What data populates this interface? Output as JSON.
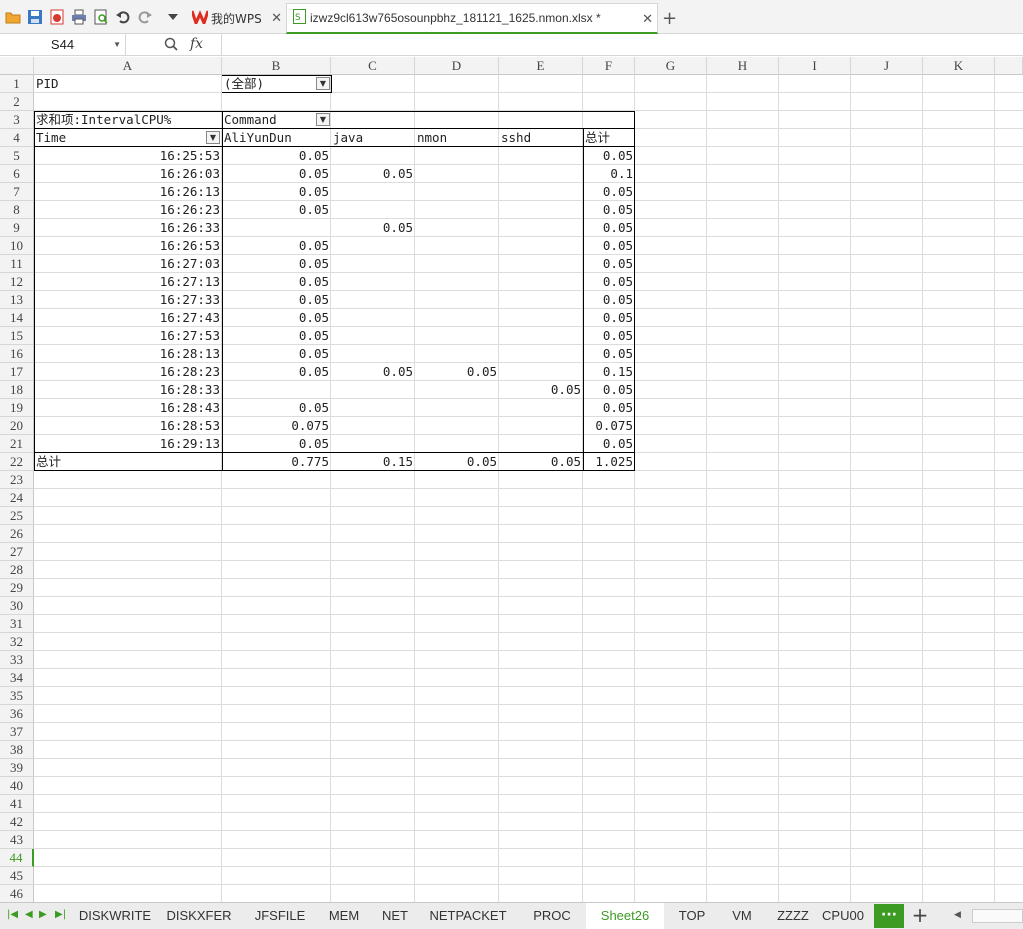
{
  "toolbar": {
    "icons": [
      "open-folder-icon",
      "save-icon",
      "export-pdf-icon",
      "print-icon",
      "print-preview-icon",
      "undo-icon",
      "redo-icon",
      "more-dropdown-icon"
    ]
  },
  "tabs": [
    {
      "label": "我的WPS",
      "active": false
    },
    {
      "label": "izwz9cl613w765osounpbhz_181121_1625.nmon.xlsx *",
      "active": true
    }
  ],
  "formula": {
    "cell_ref": "S44",
    "fx_label": "fx",
    "content": ""
  },
  "columns": [
    "A",
    "B",
    "C",
    "D",
    "E",
    "F",
    "G",
    "H",
    "I",
    "J",
    "K"
  ],
  "rows": [
    "1",
    "2",
    "3",
    "4",
    "5",
    "6",
    "7",
    "8",
    "9",
    "10",
    "11",
    "12",
    "13",
    "14",
    "15",
    "16",
    "17",
    "18",
    "19",
    "20",
    "21",
    "22",
    "23",
    "24",
    "25",
    "26",
    "27",
    "28",
    "29",
    "30",
    "31",
    "32",
    "33",
    "34",
    "35",
    "36",
    "37",
    "38",
    "39",
    "40",
    "41",
    "42",
    "43",
    "44",
    "45",
    "46"
  ],
  "active_row": "44",
  "pivot": {
    "filter_label": "PID",
    "filter_value": "(全部)",
    "value_label": "求和项:IntervalCPU%",
    "col_field": "Command",
    "row_field": "Time",
    "col_headers": [
      "AliYunDun",
      "java",
      "nmon",
      "sshd",
      "总计"
    ],
    "data": [
      [
        "16:25:53",
        "0.05",
        "",
        "",
        "",
        "0.05"
      ],
      [
        "16:26:03",
        "0.05",
        "0.05",
        "",
        "",
        "0.1"
      ],
      [
        "16:26:13",
        "0.05",
        "",
        "",
        "",
        "0.05"
      ],
      [
        "16:26:23",
        "0.05",
        "",
        "",
        "",
        "0.05"
      ],
      [
        "16:26:33",
        "",
        "0.05",
        "",
        "",
        "0.05"
      ],
      [
        "16:26:53",
        "0.05",
        "",
        "",
        "",
        "0.05"
      ],
      [
        "16:27:03",
        "0.05",
        "",
        "",
        "",
        "0.05"
      ],
      [
        "16:27:13",
        "0.05",
        "",
        "",
        "",
        "0.05"
      ],
      [
        "16:27:33",
        "0.05",
        "",
        "",
        "",
        "0.05"
      ],
      [
        "16:27:43",
        "0.05",
        "",
        "",
        "",
        "0.05"
      ],
      [
        "16:27:53",
        "0.05",
        "",
        "",
        "",
        "0.05"
      ],
      [
        "16:28:13",
        "0.05",
        "",
        "",
        "",
        "0.05"
      ],
      [
        "16:28:23",
        "0.05",
        "0.05",
        "0.05",
        "",
        "0.15"
      ],
      [
        "16:28:33",
        "",
        "",
        "",
        "0.05",
        "0.05"
      ],
      [
        "16:28:43",
        "0.05",
        "",
        "",
        "",
        "0.05"
      ],
      [
        "16:28:53",
        "0.075",
        "",
        "",
        "",
        "0.075"
      ],
      [
        "16:29:13",
        "0.05",
        "",
        "",
        "",
        "0.05"
      ]
    ],
    "total_row": [
      "总计",
      "0.775",
      "0.15",
      "0.05",
      "0.05",
      "1.025"
    ]
  },
  "sheets": [
    "DISKWRITE",
    "DISKXFER",
    "JFSFILE",
    "MEM",
    "NET",
    "NETPACKET",
    "PROC",
    "Sheet26",
    "TOP",
    "VM",
    "ZZZZ",
    "CPU00"
  ],
  "active_sheet": "Sheet26",
  "more_sheets_label": "···",
  "add_sheet_label": "+",
  "accent_color": "#3c9b22"
}
